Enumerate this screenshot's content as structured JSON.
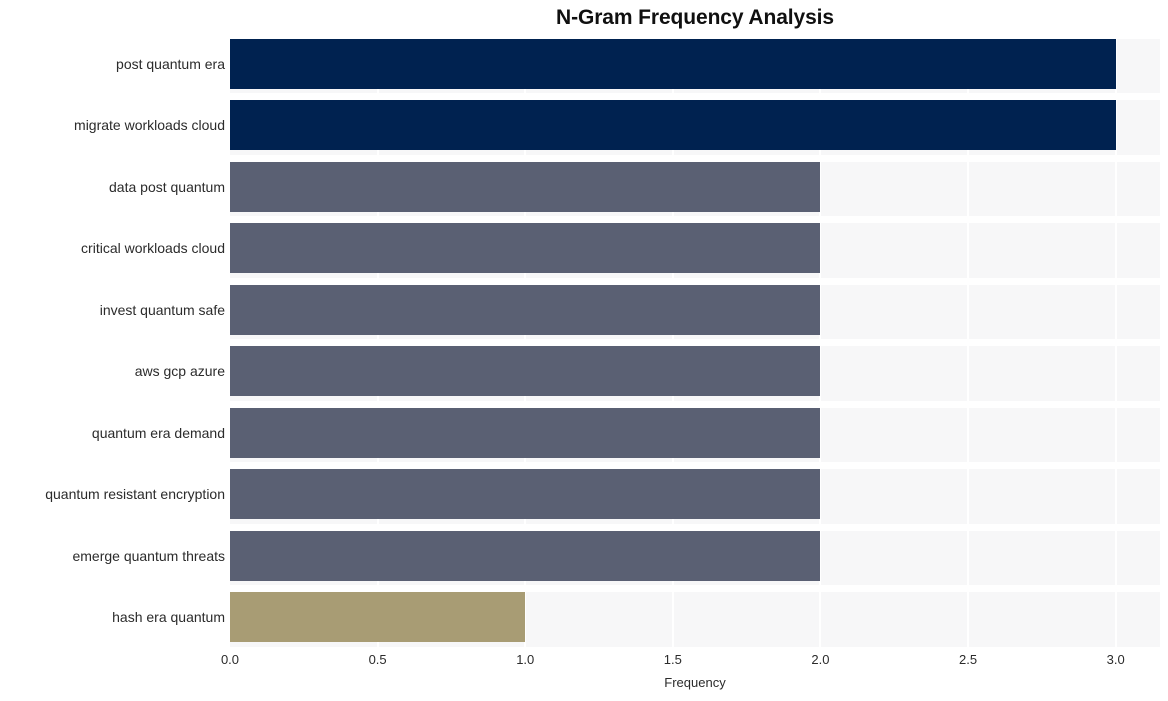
{
  "chart_data": {
    "type": "bar",
    "orientation": "horizontal",
    "title": "N-Gram Frequency Analysis",
    "xlabel": "Frequency",
    "ylabel": "",
    "xlim": [
      0.0,
      3.15
    ],
    "xticks": [
      "0.0",
      "0.5",
      "1.0",
      "1.5",
      "2.0",
      "2.5",
      "3.0"
    ],
    "xtick_values": [
      0.0,
      0.5,
      1.0,
      1.5,
      2.0,
      2.5,
      3.0
    ],
    "grid": true,
    "legend": false,
    "categories": [
      "post quantum era",
      "migrate workloads cloud",
      "data post quantum",
      "critical workloads cloud",
      "invest quantum safe",
      "aws gcp azure",
      "quantum era demand",
      "quantum resistant encryption",
      "emerge quantum threats",
      "hash era quantum"
    ],
    "values": [
      3,
      3,
      2,
      2,
      2,
      2,
      2,
      2,
      2,
      1
    ],
    "bar_colors": [
      "#002250",
      "#002250",
      "#5a6073",
      "#5a6073",
      "#5a6073",
      "#5a6073",
      "#5a6073",
      "#5a6073",
      "#5a6073",
      "#a89c74"
    ]
  },
  "colors": {
    "navy": "#002250",
    "slate": "#5a6073",
    "khaki": "#a89c74",
    "plot_background": "#f7f7f8",
    "grid": "#ffffff",
    "text": "#2b2b2b",
    "title": "#101010"
  }
}
